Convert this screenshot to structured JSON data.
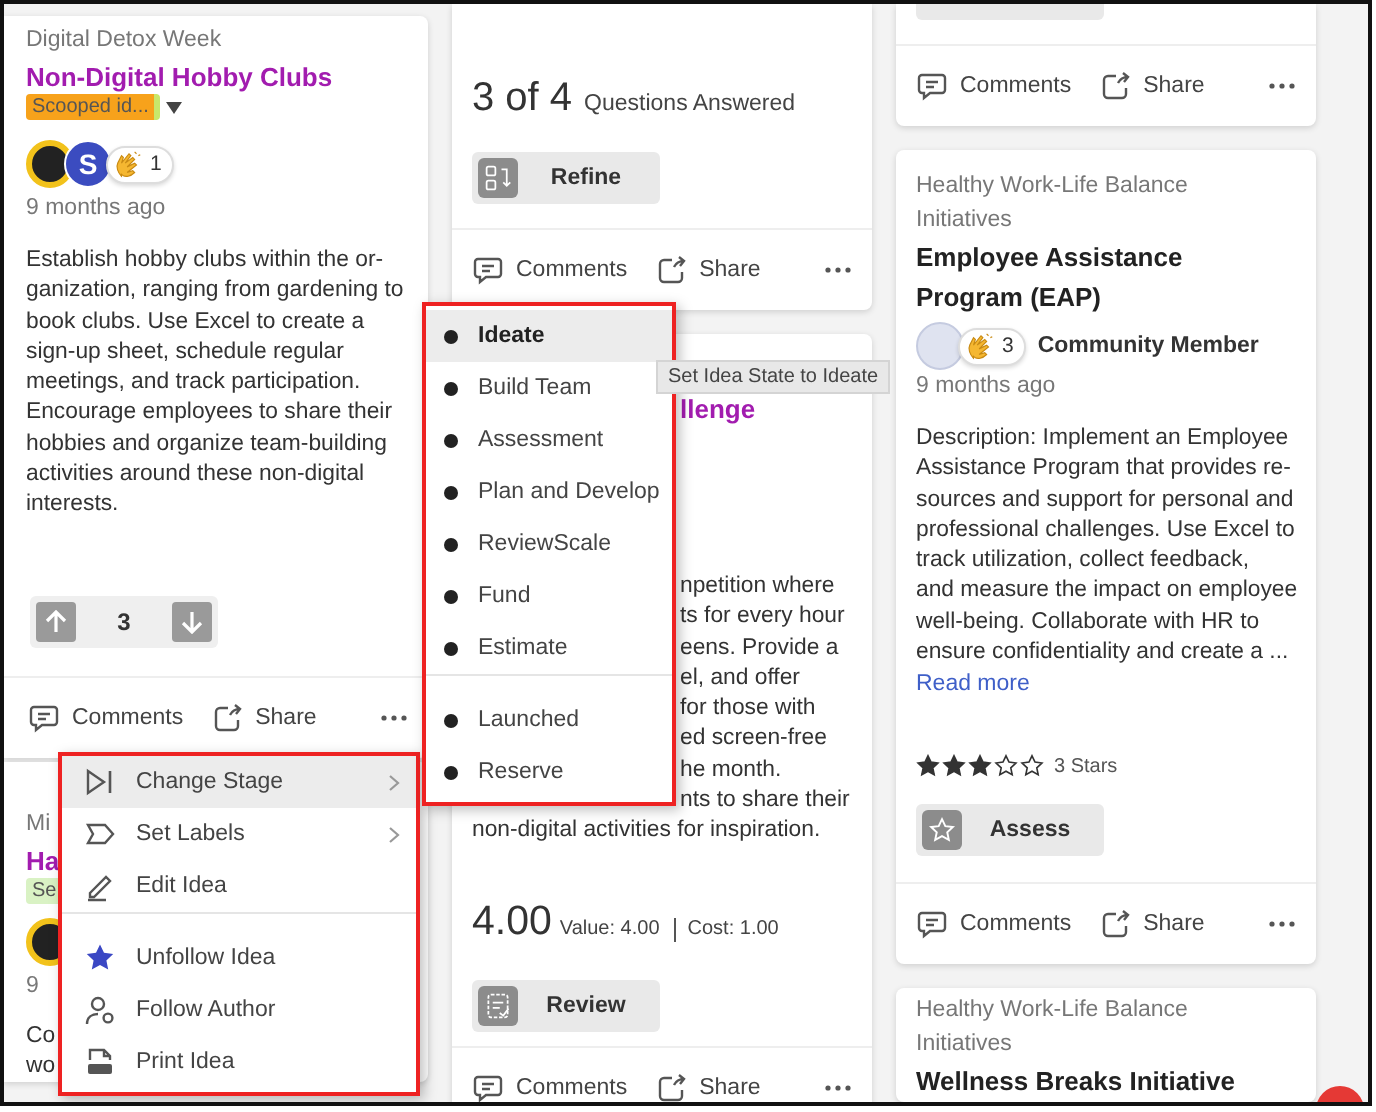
{
  "columns": [
    {
      "cards": [
        {
          "blocks": [
            {
              "kind": "category",
              "text": "Digital Detox Week"
            },
            {
              "kind": "title",
              "text": "Non-Digital Hobby Clubs",
              "accent": true
            },
            {
              "kind": "label",
              "text": "Scooped id...",
              "color": "#f7a21b",
              "menu": true
            },
            {
              "kind": "people",
              "avatars": [
                {
                  "kind": "picture"
                },
                {
                  "kind": "letter",
                  "text": "S"
                }
              ],
              "claps": "1"
            },
            {
              "kind": "time",
              "text": "9 months ago"
            },
            {
              "kind": "text",
              "lines": [
                "Establish hobby clubs within the or-",
                "ganization, ranging from gardening to",
                "book clubs. Use Excel to create a",
                "sign-up sheet, schedule regular",
                "meetings, and track participation.",
                "Encourage employees to share their",
                "hobbies and organize team-building",
                "activities around these non-digital",
                "interests."
              ]
            },
            {
              "kind": "votes",
              "count": "3"
            },
            {
              "kind": "footer",
              "comments": "Comments",
              "share": "Share"
            }
          ]
        },
        {
          "blocks": [
            {
              "kind": "category",
              "text": "Mi"
            },
            {
              "kind": "title",
              "text": "Ha",
              "accent": true
            },
            {
              "kind": "label",
              "text": "Se",
              "color": "#d9f2c4",
              "menu": false
            },
            {
              "kind": "people",
              "avatars": [
                {
                  "kind": "picture"
                }
              ]
            },
            {
              "kind": "time",
              "text": "9"
            },
            {
              "kind": "text",
              "lines": [
                "Co",
                "wo"
              ]
            }
          ]
        }
      ]
    },
    {
      "cards": [
        {
          "blocks": [
            {
              "kind": "progress",
              "count": "3 of 4",
              "text": "Questions Answered"
            },
            {
              "kind": "refine",
              "text": "Refine"
            },
            {
              "kind": "footer",
              "comments": "Comments",
              "share": "Share"
            }
          ]
        },
        {
          "blocks": [
            {
              "kind": "covered-title",
              "text": "llenge"
            },
            {
              "kind": "covered-text",
              "lines": [
                "npetition where",
                "ts for every hour",
                "eens. Provide a",
                "el, and offer",
                "for those with",
                "ed screen-free",
                "he month.",
                "nts to share their"
              ]
            },
            {
              "kind": "text",
              "lines": [
                "non-digital activities for inspiration."
              ]
            },
            {
              "kind": "score",
              "value": "4.00",
              "detail": "Value: 4.00",
              "cost": "Cost: 1.00"
            },
            {
              "kind": "review",
              "text": "Review"
            },
            {
              "kind": "footer",
              "comments": "Comments",
              "share": "Share"
            }
          ]
        }
      ]
    },
    {
      "cards": [
        {
          "blocks": [
            {
              "kind": "stub"
            },
            {
              "kind": "footer",
              "comments": "Comments",
              "share": "Share"
            }
          ]
        },
        {
          "blocks": [
            {
              "kind": "category",
              "text": "Healthy Work-Life Balance Initiatives"
            },
            {
              "kind": "title",
              "text": "Employee Assistance Program (EAP)",
              "accent": false
            },
            {
              "kind": "people",
              "avatars": [
                {
                  "kind": "blank"
                }
              ],
              "claps": "3",
              "author": "Community Member"
            },
            {
              "kind": "time",
              "text": "9 months ago"
            },
            {
              "kind": "text",
              "lines": [
                "Description: Implement an Employee",
                "Assistance Program that provides re-",
                "sources and support for personal and",
                "professional challenges. Use Excel to",
                "track utilization, collect feedback,",
                "and measure the impact on employee",
                "well-being. Collaborate with HR to",
                "ensure confidentiality and create a ..."
              ]
            },
            {
              "kind": "readmore",
              "text": "Read more"
            },
            {
              "kind": "stars",
              "stars": 3,
              "text": "3 Stars"
            },
            {
              "kind": "assess",
              "text": "Assess"
            },
            {
              "kind": "footer",
              "comments": "Comments",
              "share": "Share"
            }
          ]
        },
        {
          "blocks": [
            {
              "kind": "category",
              "text": "Healthy Work-Life Balance Initiatives"
            },
            {
              "kind": "title",
              "text": "Wellness Breaks Initiative",
              "accent": false
            }
          ]
        }
      ]
    }
  ],
  "context_menu": {
    "groups": [
      [
        {
          "kind": "stage",
          "label": "Change Stage",
          "submenu": true,
          "selected": true
        },
        {
          "kind": "labels",
          "label": "Set Labels",
          "submenu": true,
          "selected": false
        },
        {
          "kind": "edit",
          "label": "Edit Idea",
          "submenu": false,
          "selected": false
        }
      ],
      [
        {
          "kind": "unfollow",
          "label": "Unfollow Idea",
          "submenu": false,
          "selected": false
        },
        {
          "kind": "follow",
          "label": "Follow Author",
          "submenu": false,
          "selected": false
        },
        {
          "kind": "print",
          "label": "Print Idea",
          "submenu": false,
          "selected": false
        }
      ]
    ]
  },
  "stage_menu": {
    "groups": [
      [
        {
          "label": "Ideate",
          "selected": true
        },
        {
          "label": "Build Team",
          "selected": false
        },
        {
          "label": "Assessment",
          "selected": false
        },
        {
          "label": "Plan and Develop",
          "selected": false
        },
        {
          "label": "ReviewScale",
          "selected": false
        },
        {
          "label": "Fund",
          "selected": false
        },
        {
          "label": "Estimate",
          "selected": false
        }
      ],
      [
        {
          "label": "Launched",
          "selected": false
        },
        {
          "label": "Reserve",
          "selected": false
        }
      ]
    ]
  },
  "tooltip": {
    "text": "Set Idea State to Ideate"
  }
}
